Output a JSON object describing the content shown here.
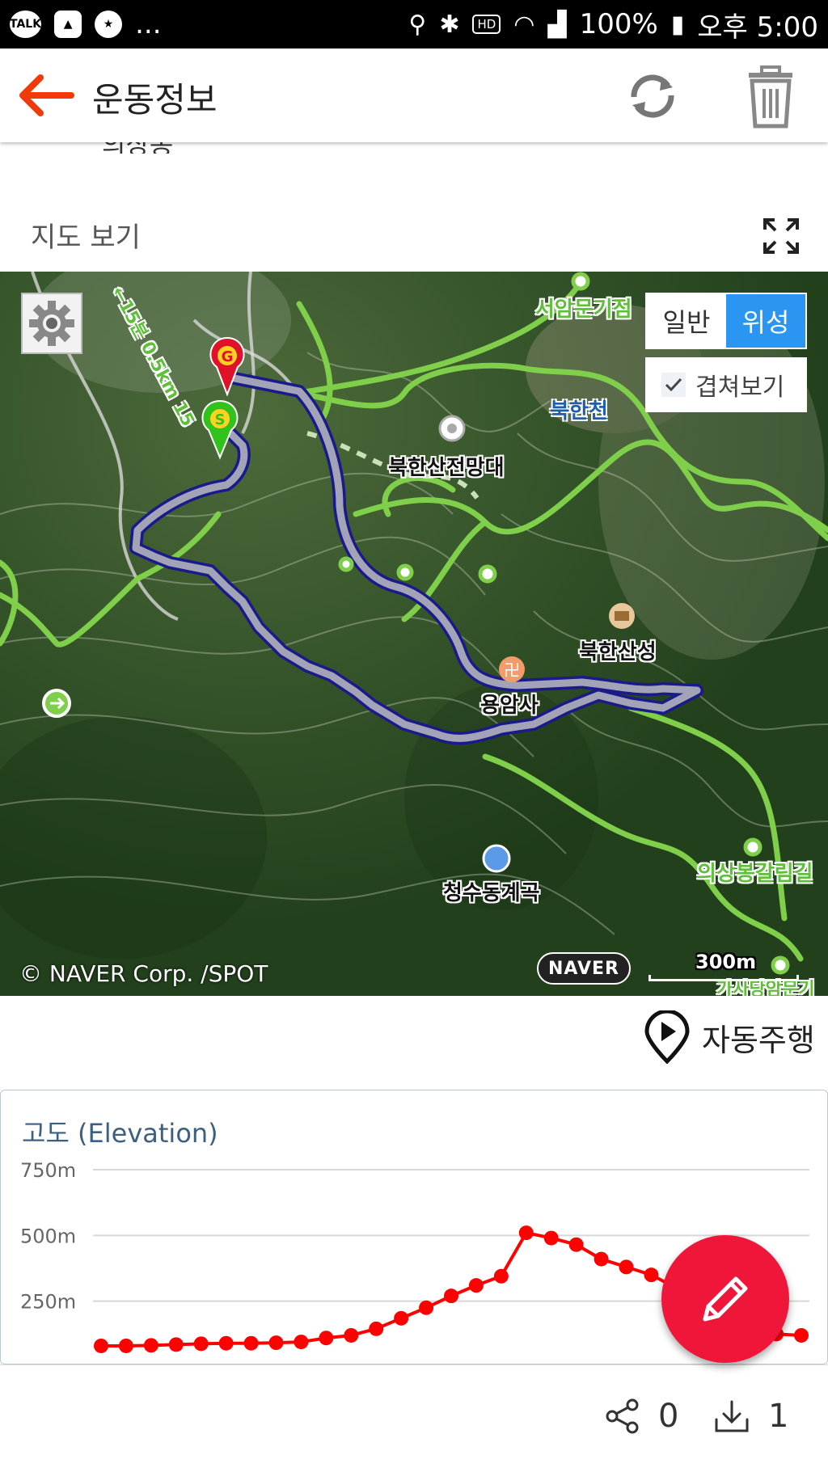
{
  "status_bar": {
    "notif_icons": [
      "talk-icon",
      "gallery-icon",
      "star-badge-icon"
    ],
    "more": "...",
    "hd": "HD",
    "battery": "100%",
    "time": "오후 5:00"
  },
  "header": {
    "title": "운동정보",
    "back_icon": "arrow-left-icon",
    "refresh_icon": "refresh-icon",
    "delete_icon": "trash-icon"
  },
  "partial_text": "의상봉",
  "map_section": {
    "label": "지도 보기",
    "map_type": {
      "options": [
        "일반",
        "위성"
      ],
      "selected": "위성"
    },
    "overlay": {
      "label": "겹쳐보기",
      "checked": true
    },
    "labels": {
      "seoammun": "서암문기점",
      "bukhancheon": "북한천",
      "observatory": "북한산전망대",
      "fortress": "북한산성",
      "yongamsa": "용암사",
      "valley": "청수동계곡",
      "uisang_trail": "의상봉갈림길",
      "bottom_right": "가사당암문기",
      "trail_info": "←15분 0.5km 15"
    },
    "copyright": "© NAVER Corp. /SPOT",
    "logo": "NAVER",
    "scale": "300m",
    "start_marker": "S",
    "goal_marker": "G",
    "accent_color": "#2b95f2",
    "route_color": "#9a9ab2"
  },
  "autoplay": {
    "label": "자동주행"
  },
  "elevation": {
    "title": "고도 (Elevation)",
    "line_color": "#ff0000"
  },
  "chart_data": {
    "type": "line",
    "title": "고도 (Elevation)",
    "xlabel": "",
    "ylabel": "",
    "y_ticks": [
      "750m",
      "500m",
      "250m"
    ],
    "ylim": [
      0,
      750
    ],
    "series": [
      {
        "values": [
          80,
          80,
          82,
          85,
          88,
          90,
          90,
          92,
          95,
          110,
          120,
          145,
          185,
          225,
          270,
          310,
          345,
          510,
          490,
          465,
          410,
          380,
          350,
          300,
          260,
          200,
          150,
          125,
          120
        ]
      }
    ]
  },
  "fab": {
    "icon": "pencil-icon",
    "color": "#f0163a"
  },
  "bottom_bar": {
    "share_count": "0",
    "download_count": "1"
  }
}
